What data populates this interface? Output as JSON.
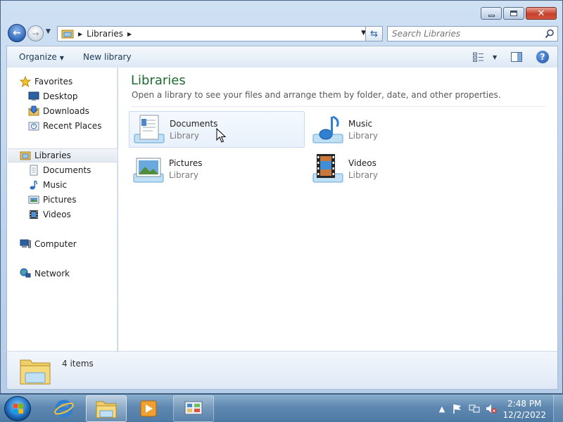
{
  "window": {
    "controls": {
      "minimize": "minimize",
      "maximize": "maximize",
      "close": "close"
    }
  },
  "address_bar": {
    "path": "Libraries",
    "search_placeholder": "Search Libraries"
  },
  "toolbar": {
    "organize_label": "Organize",
    "new_library_label": "New library"
  },
  "nav": {
    "favorites": {
      "label": "Favorites",
      "items": [
        "Desktop",
        "Downloads",
        "Recent Places"
      ]
    },
    "libraries": {
      "label": "Libraries",
      "items": [
        "Documents",
        "Music",
        "Pictures",
        "Videos"
      ]
    },
    "computer": {
      "label": "Computer"
    },
    "network": {
      "label": "Network"
    }
  },
  "content": {
    "title": "Libraries",
    "subtitle": "Open a library to see your files and arrange them by folder, date, and other properties.",
    "libraries": [
      {
        "name": "Documents",
        "type": "Library",
        "icon": "documents-library-icon"
      },
      {
        "name": "Music",
        "type": "Library",
        "icon": "music-library-icon"
      },
      {
        "name": "Pictures",
        "type": "Library",
        "icon": "pictures-library-icon"
      },
      {
        "name": "Videos",
        "type": "Library",
        "icon": "videos-library-icon"
      }
    ]
  },
  "details": {
    "count": "4 items"
  },
  "taskbar": {
    "pinned": [
      "internet-explorer-icon",
      "windows-explorer-icon",
      "media-player-icon",
      "control-panel-icon"
    ],
    "clock_time": "2:48 PM",
    "clock_date": "12/2/2022"
  },
  "colors": {
    "title_green": "#1e6b2f",
    "window_frame": "#bcd3ee",
    "close_red": "#c7412d",
    "taskbar_blue": "#5f88b0"
  }
}
